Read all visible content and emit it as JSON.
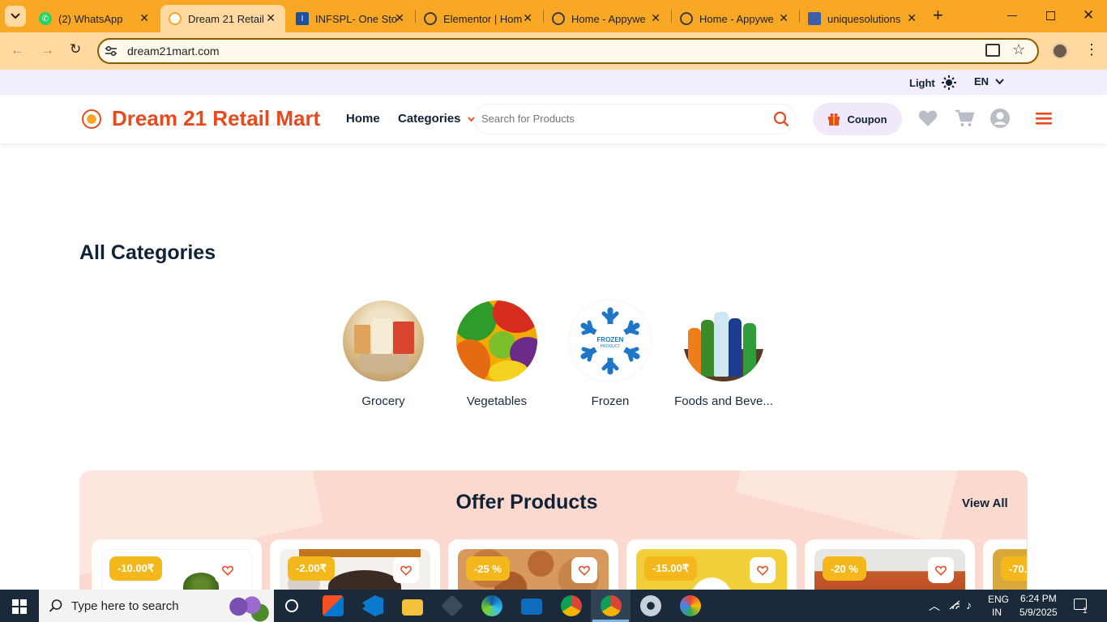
{
  "browser": {
    "tabs": [
      {
        "title": "(2) WhatsApp",
        "color": "#25d366"
      },
      {
        "title": "Dream 21 Retail",
        "color": "#f6a623"
      },
      {
        "title": "INFSPL- One Sto",
        "color": "#1e4f9c"
      },
      {
        "title": "Elementor | Hom",
        "color": "#3c3c3c"
      },
      {
        "title": "Home - Appywe",
        "color": "#3c3c3c"
      },
      {
        "title": "Home - Appywe",
        "color": "#3c3c3c"
      },
      {
        "title": "uniquesolutions",
        "color": "#3b5fa8"
      }
    ],
    "url": "dream21mart.com"
  },
  "site": {
    "theme_label": "Light",
    "language": "EN",
    "brand": "Dream 21 Retail Mart",
    "nav": {
      "home": "Home",
      "categories": "Categories"
    },
    "search_placeholder": "Search for Products",
    "coupon_label": "Coupon",
    "accent": "#e8491d",
    "all_categories_title": "All Categories",
    "categories": [
      {
        "label": "Grocery"
      },
      {
        "label": "Vegetables"
      },
      {
        "label": "Frozen"
      },
      {
        "label": "Foods and Beve..."
      }
    ],
    "frozen_badge": [
      "FROZEN",
      "PRODUCT"
    ],
    "offers": {
      "title": "Offer Products",
      "view_all": "View All",
      "products": [
        {
          "discount": "-10.00₹"
        },
        {
          "discount": "-2.00₹"
        },
        {
          "discount": "-25 %"
        },
        {
          "discount": "-15.00₹"
        },
        {
          "discount": "-20 %"
        },
        {
          "discount": "-70."
        }
      ]
    }
  },
  "taskbar": {
    "search_placeholder": "Type here to search",
    "lang_line1": "ENG",
    "lang_line2": "IN",
    "time": "6:24 PM",
    "date": "5/9/2025",
    "notification_count": "1"
  }
}
